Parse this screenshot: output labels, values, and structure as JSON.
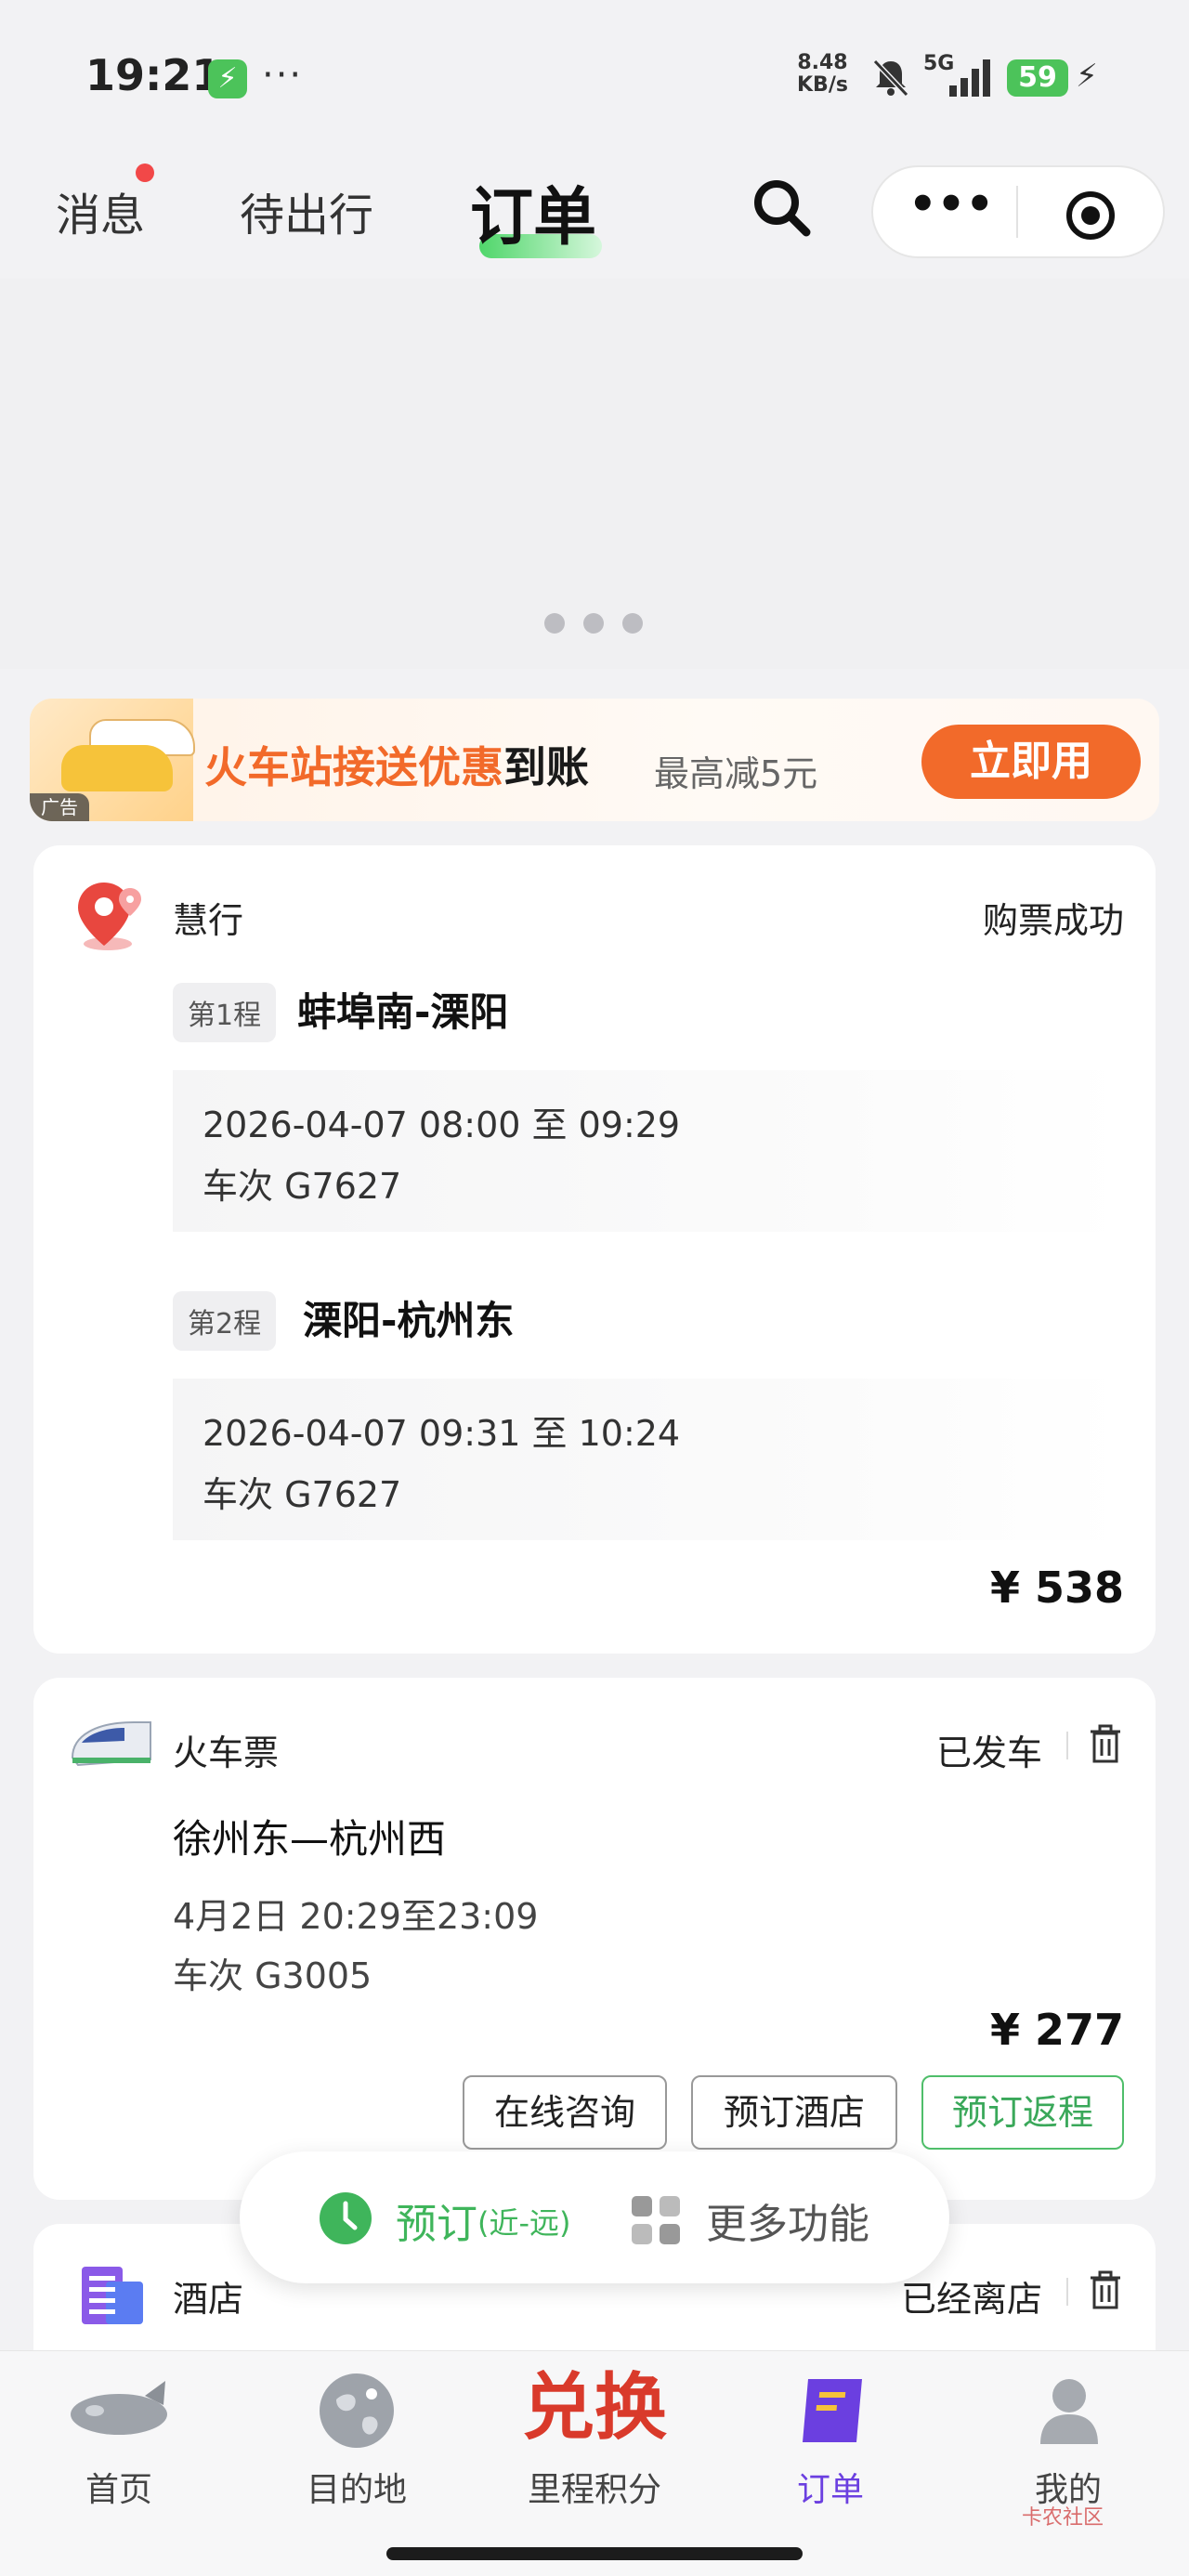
{
  "status_bar": {
    "time": "19:21",
    "net_speed": "8.48",
    "net_unit": "KB/s",
    "net_type": "5G",
    "battery": "59"
  },
  "top_nav": {
    "tabs": [
      "消息",
      "待出行",
      "订单"
    ],
    "active_tab": "订单"
  },
  "ad": {
    "tag": "广告",
    "title_colored": "火车站接送优惠",
    "title_dark": "到账",
    "subtitle": "最高减5元",
    "button": "立即用"
  },
  "card1": {
    "brand": "慧行",
    "status": "购票成功",
    "segments": [
      {
        "tag": "第1程",
        "route": "蚌埠南-溧阳",
        "time": "2026-04-07 08:00 至 09:29",
        "train": "车次 G7627"
      },
      {
        "tag": "第2程",
        "route": "溧阳-杭州东",
        "time": "2026-04-07 09:31 至 10:24",
        "train": "车次 G7627"
      }
    ],
    "price": "¥ 538"
  },
  "card2": {
    "type": "火车票",
    "status": "已发车",
    "route": "徐州东—杭州西",
    "time": "4月2日 20:29至23:09",
    "train": "车次 G3005",
    "price": "¥ 277",
    "buttons": [
      "在线咨询",
      "预订酒店",
      "预订返程"
    ]
  },
  "card3": {
    "type": "酒店",
    "status": "已经离店"
  },
  "float_bar": {
    "book": "预订",
    "range": "(近-远)",
    "more": "更多功能"
  },
  "tabbar": {
    "items": [
      "首页",
      "目的地",
      "里程积分",
      "订单",
      "我的"
    ],
    "exchange_text": "兑换"
  },
  "watermark": "卡农社区",
  "colors": {
    "accent_green": "#3fb55b",
    "ad_orange": "#f26a2a",
    "order_purple": "#6b3fe0"
  }
}
